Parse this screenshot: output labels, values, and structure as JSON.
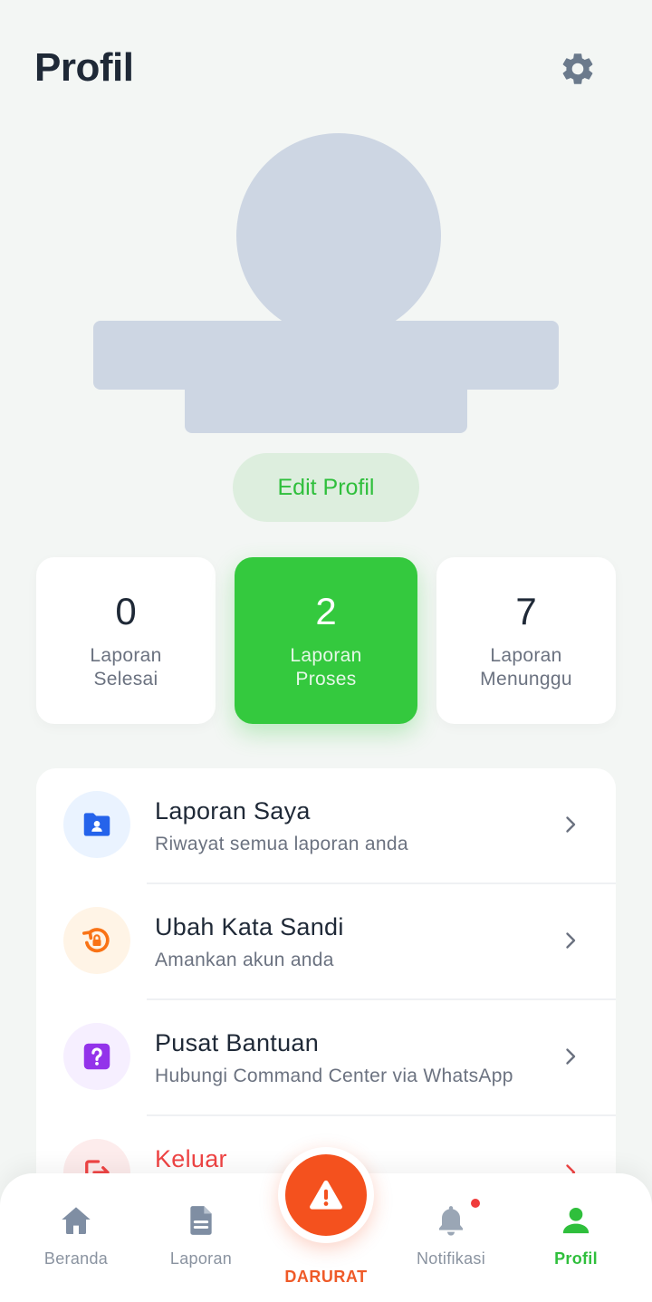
{
  "header": {
    "title": "Profil"
  },
  "profile": {
    "edit_label": "Edit Profil"
  },
  "stats": [
    {
      "value": "0",
      "label_line1": "Laporan",
      "label_line2": "Selesai"
    },
    {
      "value": "2",
      "label_line1": "Laporan",
      "label_line2": "Proses"
    },
    {
      "value": "7",
      "label_line1": "Laporan",
      "label_line2": "Menunggu"
    }
  ],
  "menu": [
    {
      "title": "Laporan Saya",
      "subtitle": "Riwayat semua laporan anda",
      "icon": "folder-user-icon"
    },
    {
      "title": "Ubah Kata Sandi",
      "subtitle": "Amankan akun anda",
      "icon": "lock-reset-icon"
    },
    {
      "title": "Pusat Bantuan",
      "subtitle": "Hubungi Command Center via WhatsApp",
      "icon": "help-icon"
    },
    {
      "title": "Keluar",
      "subtitle": "",
      "icon": "logout-icon"
    }
  ],
  "bottom_nav": {
    "items": [
      {
        "label": "Beranda",
        "icon": "home-icon"
      },
      {
        "label": "Laporan",
        "icon": "document-icon"
      },
      {
        "label": "Notifikasi",
        "icon": "bell-icon"
      },
      {
        "label": "Profil",
        "icon": "user-icon"
      }
    ],
    "emergency_label": "DARURAT"
  },
  "colors": {
    "accent": "#34c93e",
    "emergency": "#f4511e",
    "text_primary": "#1f2937",
    "text_secondary": "#6b7280",
    "notification_dot": "#ef3b3b"
  }
}
